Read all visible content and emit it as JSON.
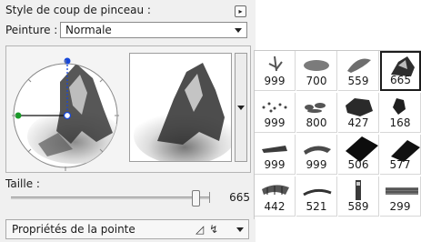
{
  "brush_panel": {
    "title": "Style de coup de pinceau :",
    "expand_symbol": "▸",
    "paint_label": "Peinture :",
    "paint_mode": "Normale",
    "size_label": "Taille :",
    "size_value": "665",
    "tip_properties_label": "Propriétés de la pointe",
    "tip_icon_1": "◿",
    "tip_icon_2": "↯"
  },
  "brushes": [
    {
      "size": "999"
    },
    {
      "size": "700"
    },
    {
      "size": "559"
    },
    {
      "size": "665",
      "selected": true
    },
    {
      "size": "999"
    },
    {
      "size": "800"
    },
    {
      "size": "427"
    },
    {
      "size": "168"
    },
    {
      "size": "999"
    },
    {
      "size": "999"
    },
    {
      "size": "506"
    },
    {
      "size": "577"
    },
    {
      "size": "442"
    },
    {
      "size": "521"
    },
    {
      "size": "589"
    },
    {
      "size": "299"
    }
  ],
  "colors": {
    "panel_bg": "#f0f0f0",
    "handle_blue": "#1747d8",
    "handle_green": "#1a9a2a"
  }
}
